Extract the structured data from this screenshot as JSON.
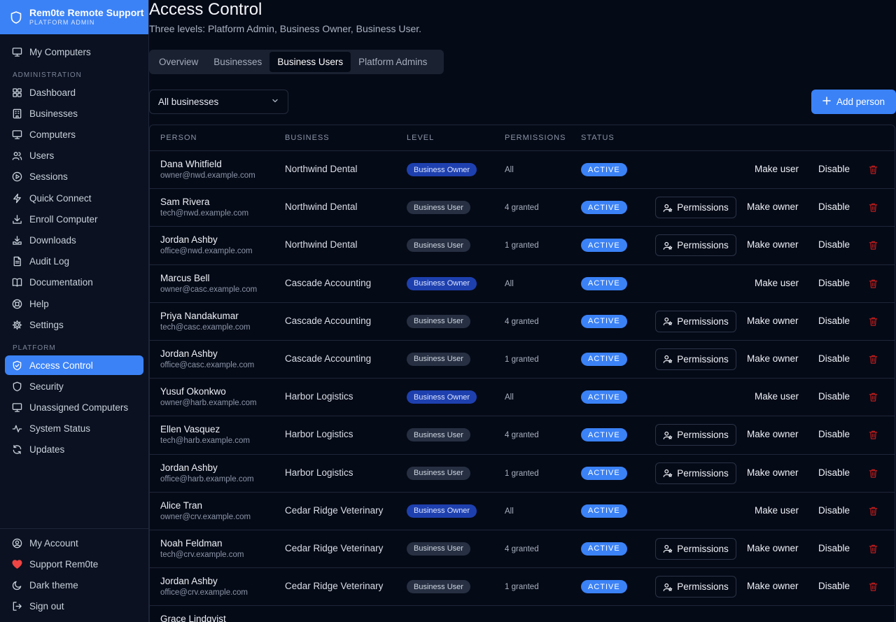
{
  "brand": {
    "name": "Rem0te Remote Support",
    "sub": "PLATFORM ADMIN"
  },
  "sidebar": {
    "top_items": [
      {
        "label": "My Computers",
        "icon": "monitor-icon"
      }
    ],
    "admin_section": "ADMINISTRATION",
    "admin_items": [
      {
        "label": "Dashboard",
        "icon": "dashboard-icon"
      },
      {
        "label": "Businesses",
        "icon": "building-icon"
      },
      {
        "label": "Computers",
        "icon": "monitor-icon"
      },
      {
        "label": "Users",
        "icon": "users-icon"
      },
      {
        "label": "Sessions",
        "icon": "play-circle-icon"
      },
      {
        "label": "Quick Connect",
        "icon": "zap-icon"
      },
      {
        "label": "Enroll Computer",
        "icon": "download-icon"
      },
      {
        "label": "Downloads",
        "icon": "download-tray-icon"
      },
      {
        "label": "Audit Log",
        "icon": "file-text-icon"
      },
      {
        "label": "Documentation",
        "icon": "book-icon"
      },
      {
        "label": "Help",
        "icon": "help-icon"
      },
      {
        "label": "Settings",
        "icon": "gear-icon"
      }
    ],
    "platform_section": "PLATFORM",
    "platform_items": [
      {
        "label": "Access Control",
        "icon": "shield-check-icon",
        "active": true
      },
      {
        "label": "Security",
        "icon": "shield-icon"
      },
      {
        "label": "Unassigned Computers",
        "icon": "monitor-icon"
      },
      {
        "label": "System Status",
        "icon": "activity-icon"
      },
      {
        "label": "Updates",
        "icon": "refresh-icon"
      }
    ],
    "bottom_items": [
      {
        "label": "My Account",
        "icon": "user-circle-icon"
      },
      {
        "label": "Support Rem0te",
        "icon": "heart-icon"
      },
      {
        "label": "Dark theme",
        "icon": "moon-icon"
      },
      {
        "label": "Sign out",
        "icon": "sign-out-icon"
      }
    ]
  },
  "page": {
    "title": "Access Control",
    "subtitle": "Three levels: Platform Admin, Business Owner, Business User.",
    "tabs": [
      {
        "label": "Overview"
      },
      {
        "label": "Businesses"
      },
      {
        "label": "Business Users",
        "active": true
      },
      {
        "label": "Platform Admins"
      }
    ],
    "filter": {
      "value": "All businesses"
    },
    "add_label": "Add person"
  },
  "table": {
    "columns": [
      "PERSON",
      "BUSINESS",
      "LEVEL",
      "PERMISSIONS",
      "STATUS"
    ],
    "permissions_label": "Permissions",
    "disable_label": "Disable",
    "rows": [
      {
        "name": "Dana Whitfield",
        "email": "owner@nwd.example.com",
        "business": "Northwind Dental",
        "level": "Business Owner",
        "owner": true,
        "perms": "All",
        "status": "ACTIVE",
        "toggle": "Make user"
      },
      {
        "name": "Sam Rivera",
        "email": "tech@nwd.example.com",
        "business": "Northwind Dental",
        "level": "Business User",
        "owner": false,
        "perms": "4 granted",
        "status": "ACTIVE",
        "toggle": "Make owner"
      },
      {
        "name": "Jordan Ashby",
        "email": "office@nwd.example.com",
        "business": "Northwind Dental",
        "level": "Business User",
        "owner": false,
        "perms": "1 granted",
        "status": "ACTIVE",
        "toggle": "Make owner"
      },
      {
        "name": "Marcus Bell",
        "email": "owner@casc.example.com",
        "business": "Cascade Accounting",
        "level": "Business Owner",
        "owner": true,
        "perms": "All",
        "status": "ACTIVE",
        "toggle": "Make user"
      },
      {
        "name": "Priya Nandakumar",
        "email": "tech@casc.example.com",
        "business": "Cascade Accounting",
        "level": "Business User",
        "owner": false,
        "perms": "4 granted",
        "status": "ACTIVE",
        "toggle": "Make owner"
      },
      {
        "name": "Jordan Ashby",
        "email": "office@casc.example.com",
        "business": "Cascade Accounting",
        "level": "Business User",
        "owner": false,
        "perms": "1 granted",
        "status": "ACTIVE",
        "toggle": "Make owner"
      },
      {
        "name": "Yusuf Okonkwo",
        "email": "owner@harb.example.com",
        "business": "Harbor Logistics",
        "level": "Business Owner",
        "owner": true,
        "perms": "All",
        "status": "ACTIVE",
        "toggle": "Make user"
      },
      {
        "name": "Ellen Vasquez",
        "email": "tech@harb.example.com",
        "business": "Harbor Logistics",
        "level": "Business User",
        "owner": false,
        "perms": "4 granted",
        "status": "ACTIVE",
        "toggle": "Make owner"
      },
      {
        "name": "Jordan Ashby",
        "email": "office@harb.example.com",
        "business": "Harbor Logistics",
        "level": "Business User",
        "owner": false,
        "perms": "1 granted",
        "status": "ACTIVE",
        "toggle": "Make owner"
      },
      {
        "name": "Alice Tran",
        "email": "owner@crv.example.com",
        "business": "Cedar Ridge Veterinary",
        "level": "Business Owner",
        "owner": true,
        "perms": "All",
        "status": "ACTIVE",
        "toggle": "Make user"
      },
      {
        "name": "Noah Feldman",
        "email": "tech@crv.example.com",
        "business": "Cedar Ridge Veterinary",
        "level": "Business User",
        "owner": false,
        "perms": "4 granted",
        "status": "ACTIVE",
        "toggle": "Make owner"
      },
      {
        "name": "Jordan Ashby",
        "email": "office@crv.example.com",
        "business": "Cedar Ridge Veterinary",
        "level": "Business User",
        "owner": false,
        "perms": "1 granted",
        "status": "ACTIVE",
        "toggle": "Make owner"
      },
      {
        "name": "Grace Lindqvist",
        "email": "",
        "business": "",
        "level": "",
        "owner": true,
        "perms": "",
        "status": "",
        "toggle": ""
      }
    ]
  }
}
